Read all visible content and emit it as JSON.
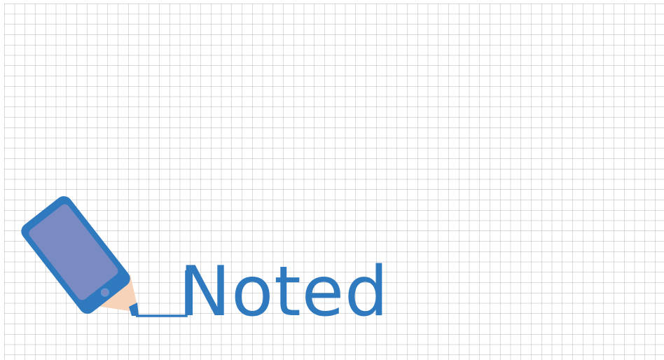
{
  "logo": {
    "wordmark": "Noted",
    "colors": {
      "brand_blue": "#2f79bf",
      "screen_purple": "#7a8bc4",
      "pencil_tip": "#f6d3b9",
      "grid_line": "#9a9a9a"
    },
    "icons": [
      "phone-pencil-icon"
    ]
  }
}
